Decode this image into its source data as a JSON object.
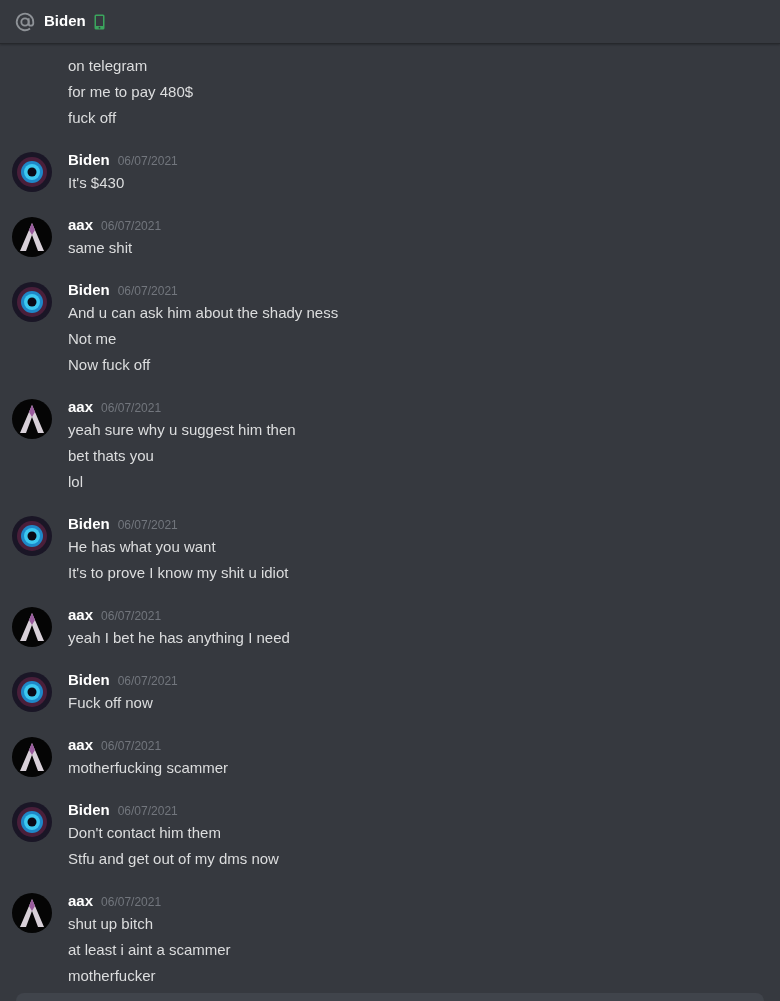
{
  "header": {
    "title": "Biden"
  },
  "messages": [
    {
      "lines": [
        "on telegram",
        "for me to pay 480$",
        "fuck off"
      ]
    },
    {
      "author": "Biden",
      "kind": "vortex",
      "time": "06/07/2021",
      "lines": [
        "It's $430"
      ]
    },
    {
      "author": "aax",
      "kind": "peak",
      "time": "06/07/2021",
      "lines": [
        "same shit"
      ]
    },
    {
      "author": "Biden",
      "kind": "vortex",
      "time": "06/07/2021",
      "lines": [
        "And u can ask him about the shady ness",
        "Not me",
        "Now fuck off"
      ]
    },
    {
      "author": "aax",
      "kind": "peak",
      "time": "06/07/2021",
      "lines": [
        "yeah sure why u suggest him then",
        "bet thats you",
        "lol"
      ]
    },
    {
      "author": "Biden",
      "kind": "vortex",
      "time": "06/07/2021",
      "lines": [
        "He has what you want",
        "It's to prove I know my shit u idiot"
      ]
    },
    {
      "author": "aax",
      "kind": "peak",
      "time": "06/07/2021",
      "lines": [
        "yeah I bet he has anything I need"
      ]
    },
    {
      "author": "Biden",
      "kind": "vortex",
      "time": "06/07/2021",
      "lines": [
        "Fuck off now"
      ]
    },
    {
      "author": "aax",
      "kind": "peak",
      "time": "06/07/2021",
      "lines": [
        "motherfucking scammer"
      ]
    },
    {
      "author": "Biden",
      "kind": "vortex",
      "time": "06/07/2021",
      "lines": [
        "Don't contact him them",
        "Stfu and get out of my dms now"
      ]
    },
    {
      "author": "aax",
      "kind": "peak",
      "time": "06/07/2021",
      "lines": [
        "shut up bitch",
        "at least i aint a scammer",
        "motherfucker"
      ]
    }
  ]
}
